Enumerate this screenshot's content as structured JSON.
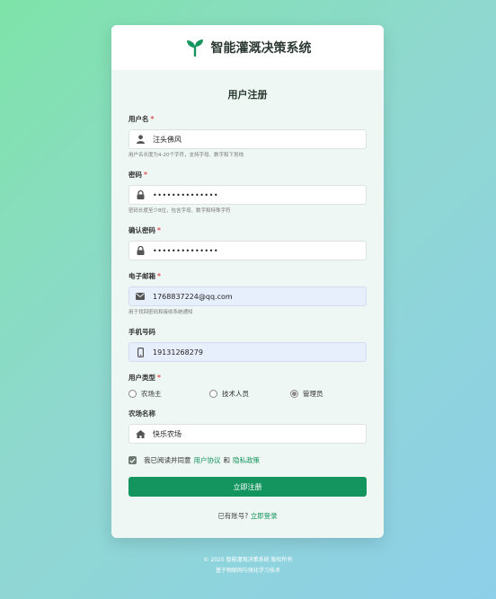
{
  "header": {
    "app_title": "智能灌溉决策系统",
    "logo_icon": "sprout-icon",
    "brand_color": "#14955f"
  },
  "form": {
    "title": "用户注册",
    "required_mark": "*",
    "username": {
      "label": "用户名",
      "value": "汪头佛风",
      "hint": "用户名长度为4-20个字符，支持字母、数字和下划线",
      "icon": "user-icon"
    },
    "password": {
      "label": "密码",
      "value": "••••••••••••••",
      "hint": "密码长度至少8位，包含字母、数字和特殊字符",
      "icon": "lock-icon"
    },
    "confirm_password": {
      "label": "确认密码",
      "value": "••••••••••••••",
      "icon": "lock-icon"
    },
    "email": {
      "label": "电子邮箱",
      "value": "1768837224@qq.com",
      "hint": "用于找回密码和接收系统通知",
      "icon": "envelope-icon"
    },
    "phone": {
      "label": "手机号码",
      "value": "19131268279",
      "icon": "phone-icon"
    },
    "user_type": {
      "label": "用户类型",
      "options": [
        {
          "label": "农场主",
          "selected": false
        },
        {
          "label": "技术人员",
          "selected": false
        },
        {
          "label": "管理员",
          "selected": true
        }
      ]
    },
    "farm_name": {
      "label": "农场名称",
      "value": "快乐农场",
      "icon": "home-icon"
    },
    "agreement": {
      "checked": true,
      "prefix": "我已阅读并同意",
      "terms_link": "用户协议",
      "and": "和",
      "privacy_link": "隐私政策"
    },
    "submit_label": "立即注册",
    "login_prompt": "已有账号?",
    "login_link": "立即登录"
  },
  "footer": {
    "line1": "© 2025 智能灌溉决策系统 版权所有",
    "line2": "基于物联网与强化学习技术"
  }
}
